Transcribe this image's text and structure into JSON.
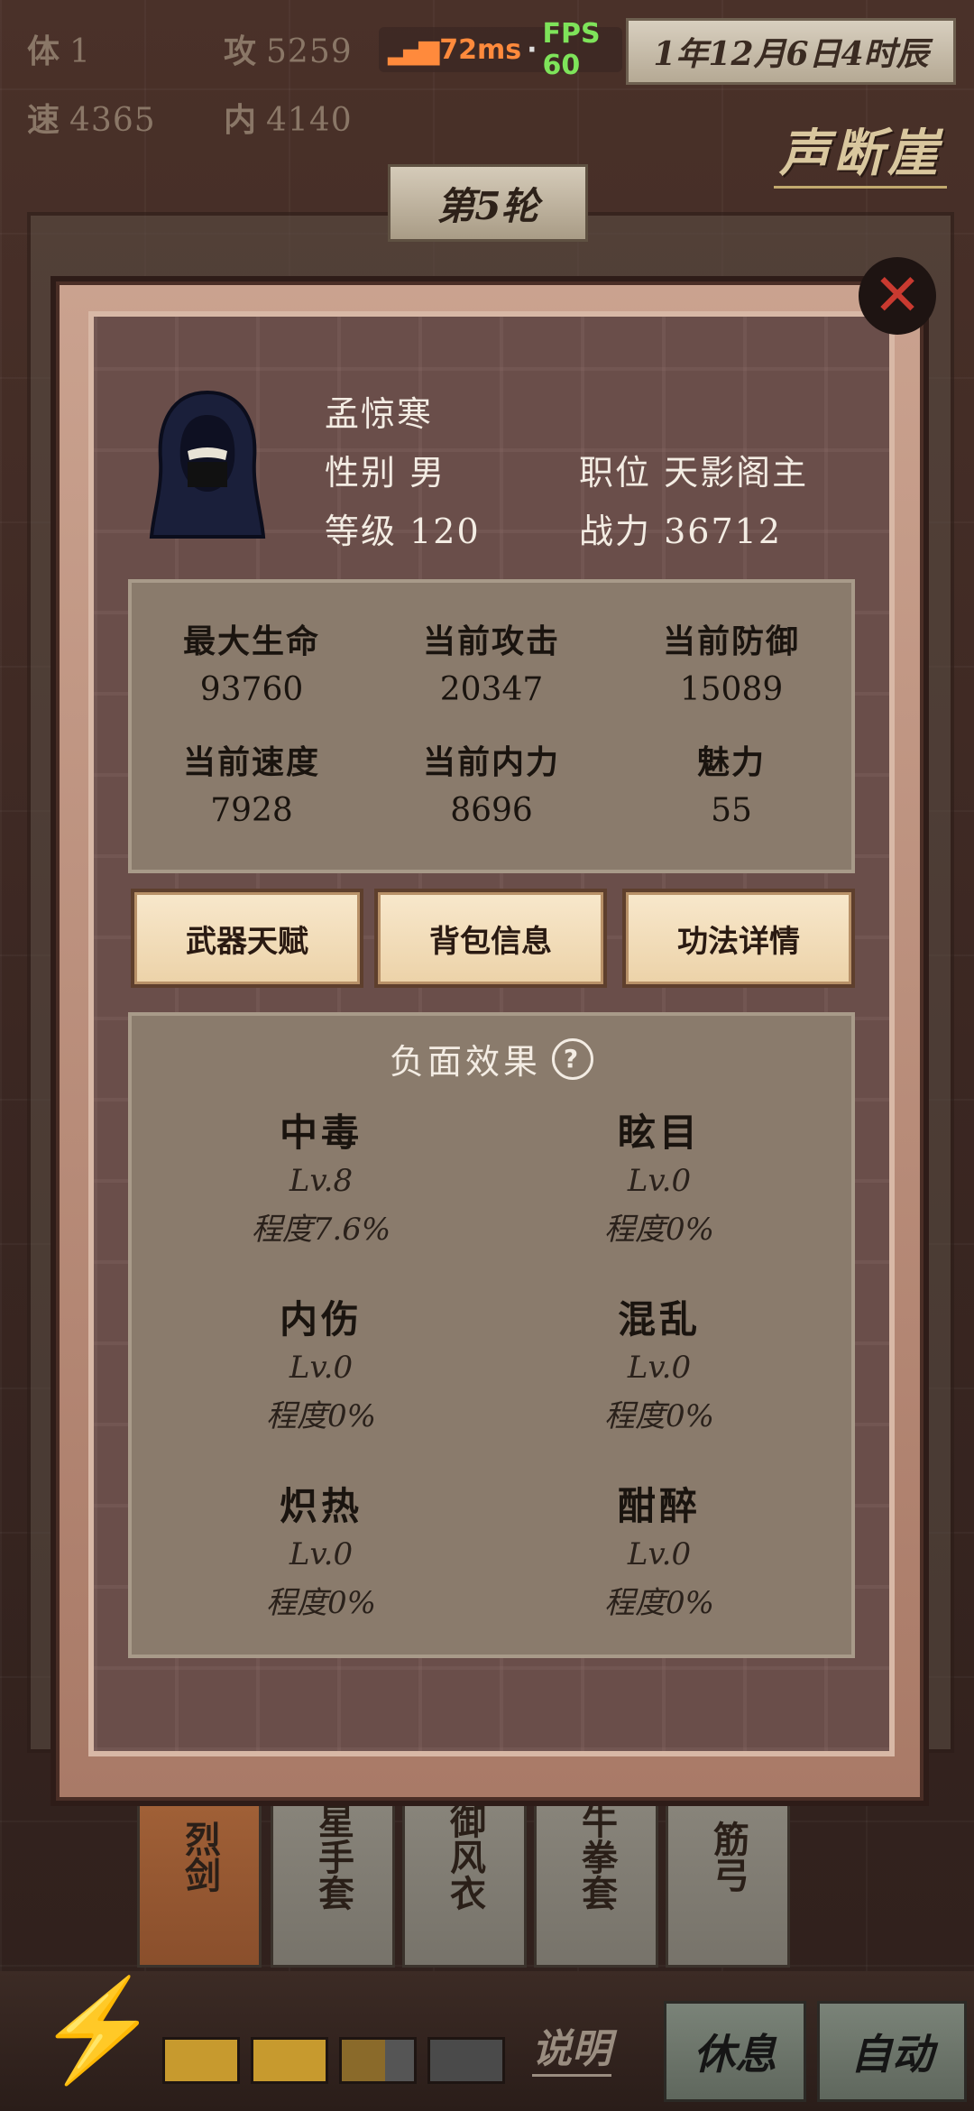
{
  "top_stats": {
    "ti_label": "体",
    "ti_value": "1",
    "gong_label": "攻",
    "gong_value": "5259",
    "su_label": "速",
    "su_value": "4365",
    "nei_label": "内",
    "nei_value": "4140"
  },
  "perf": {
    "ms": "72ms",
    "sep": "·",
    "fps": "FPS 60"
  },
  "date": "1年12月6日4时辰",
  "location": "声断崖",
  "round": "第5轮",
  "character": {
    "name": "孟惊寒",
    "gender_label": "性别",
    "gender_value": "男",
    "position_label": "职位",
    "position_value": "天影阁主",
    "level_label": "等级",
    "level_value": "120",
    "power_label": "战力",
    "power_value": "36712"
  },
  "stats": [
    {
      "label": "最大生命",
      "value": "93760"
    },
    {
      "label": "当前攻击",
      "value": "20347"
    },
    {
      "label": "当前防御",
      "value": "15089"
    },
    {
      "label": "当前速度",
      "value": "7928"
    },
    {
      "label": "当前内力",
      "value": "8696"
    },
    {
      "label": "魅力",
      "value": "55"
    }
  ],
  "tabs": [
    "武器天赋",
    "背包信息",
    "功法详情"
  ],
  "debuffs": {
    "title": "负面效果",
    "help": "?",
    "items": [
      {
        "name": "中毒",
        "level": "Lv.8",
        "degree": "程度7.6%"
      },
      {
        "name": "眩目",
        "level": "Lv.0",
        "degree": "程度0%"
      },
      {
        "name": "内伤",
        "level": "Lv.0",
        "degree": "程度0%"
      },
      {
        "name": "混乱",
        "level": "Lv.0",
        "degree": "程度0%"
      },
      {
        "name": "炽热",
        "level": "Lv.0",
        "degree": "程度0%"
      },
      {
        "name": "酣醉",
        "level": "Lv.0",
        "degree": "程度0%"
      }
    ]
  },
  "equipment": [
    "烈剑",
    "星手套",
    "御风衣",
    "牛拳套",
    "筋弓"
  ],
  "bottom": {
    "explain": "说明",
    "rest": "休息",
    "auto": "自动"
  },
  "icons": {
    "close": "close-icon",
    "bolt": "lightning-icon",
    "help": "help-icon"
  },
  "colors": {
    "accent": "#c93a30",
    "panel": "#8a7b6c",
    "tab": "#f8e8cc"
  }
}
